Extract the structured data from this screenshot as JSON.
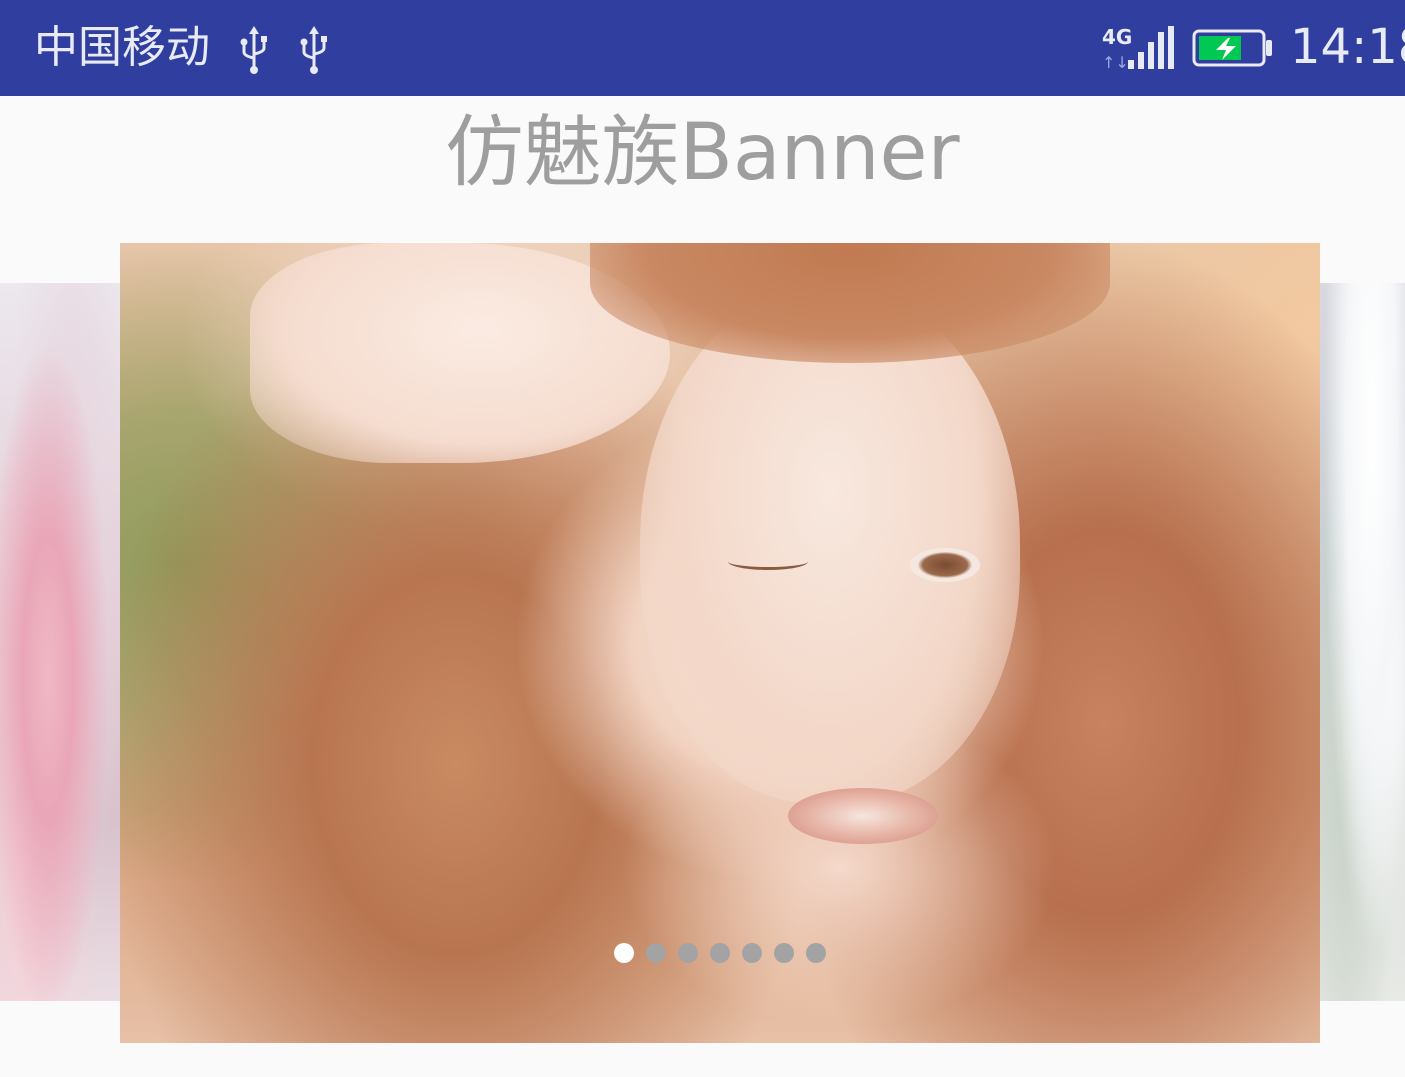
{
  "status_bar": {
    "carrier": "中国移动",
    "network_type": "4G",
    "time": "14:18",
    "icons": [
      "usb-icon",
      "usb-icon",
      "signal-icon",
      "battery-charging-icon"
    ],
    "background_color": "#303f9f"
  },
  "page": {
    "title": "仿魅族Banner"
  },
  "banner": {
    "page_count": 7,
    "active_index": 0,
    "indicator_active_color": "#ffffff",
    "indicator_inactive_color": "#a3a3a3"
  }
}
